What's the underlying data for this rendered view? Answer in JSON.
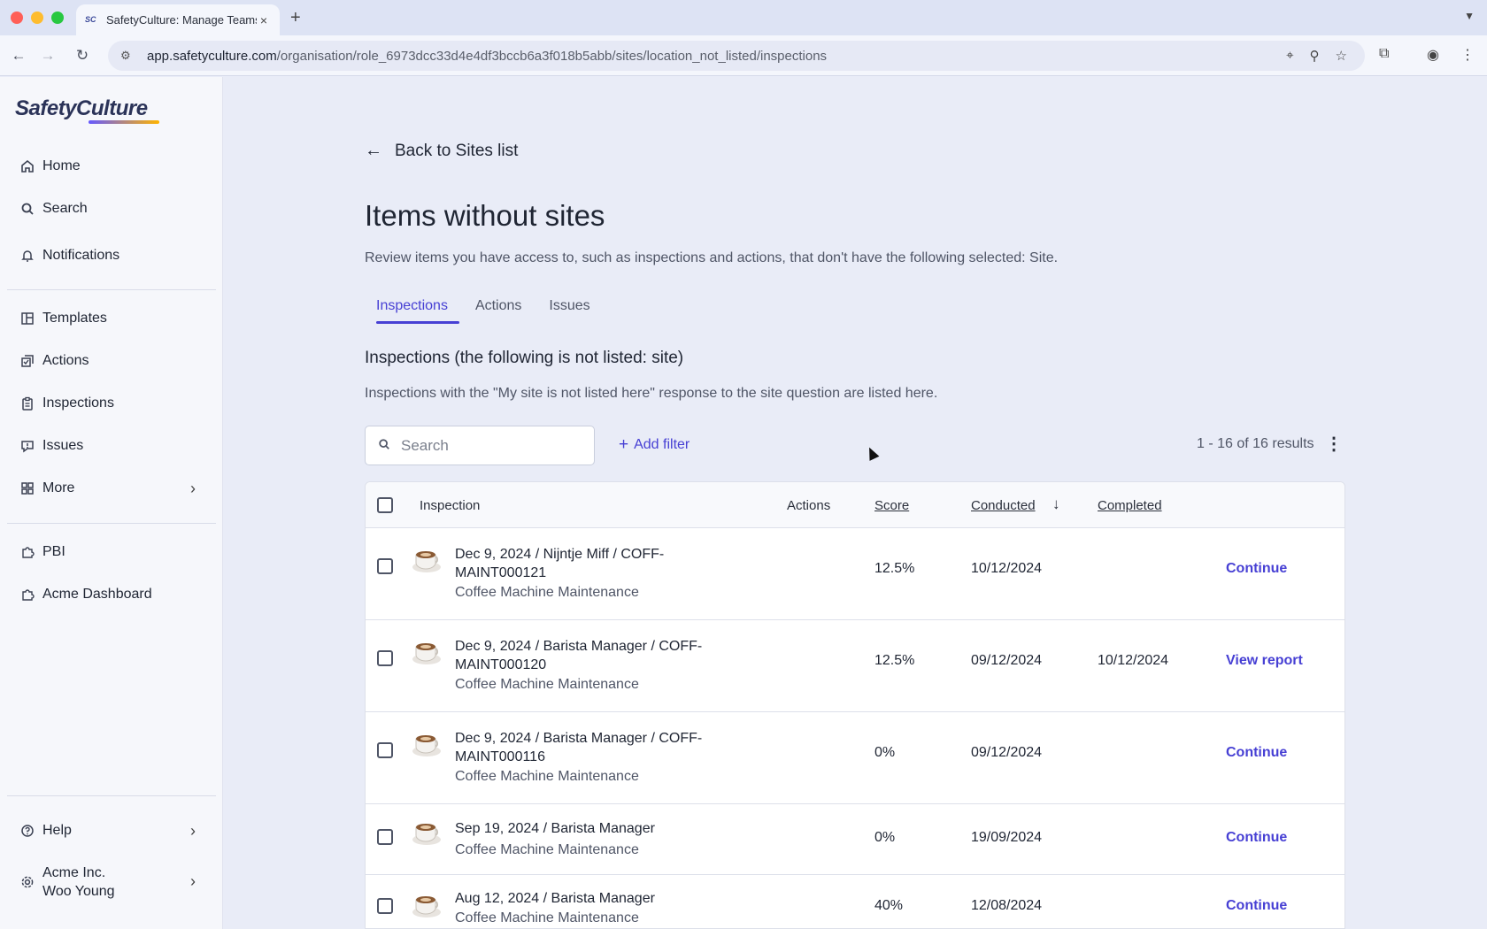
{
  "browser": {
    "tab_title": "SafetyCulture: Manage Teams",
    "favicon_text": "SC",
    "url_domain": "app.safetyculture.com",
    "url_path": "/organisation/role_6973dcc33d4e4df3bccb6a3f018b5abb/sites/location_not_listed/inspections"
  },
  "sidebar": {
    "logo": "SafetyCulture",
    "items": [
      {
        "label": "Home",
        "icon": "home-icon"
      },
      {
        "label": "Search",
        "icon": "search-icon"
      },
      {
        "label": "Notifications",
        "icon": "bell-icon"
      },
      {
        "label": "Templates",
        "icon": "templates-icon"
      },
      {
        "label": "Actions",
        "icon": "actions-icon"
      },
      {
        "label": "Inspections",
        "icon": "clipboard-icon"
      },
      {
        "label": "Issues",
        "icon": "issue-icon"
      },
      {
        "label": "More",
        "icon": "grid-icon"
      },
      {
        "label": "PBI",
        "icon": "puzzle-icon"
      },
      {
        "label": "Acme Dashboard",
        "icon": "puzzle-icon"
      }
    ],
    "help": "Help",
    "account_org": "Acme Inc.",
    "account_user": "Woo Young"
  },
  "main": {
    "back_label": "Back to Sites list",
    "title": "Items without sites",
    "description": "Review items you have access to, such as inspections and actions, that don't have the following selected: Site.",
    "tabs": [
      "Inspections",
      "Actions",
      "Issues"
    ],
    "section_title": "Inspections (the following is not listed: site)",
    "section_desc": "Inspections with the \"My site is not listed here\" response to the site question are listed here.",
    "search_placeholder": "Search",
    "add_filter": "Add filter",
    "results": "1 - 16 of 16 results"
  },
  "table": {
    "headers": {
      "inspection": "Inspection",
      "actions": "Actions",
      "score": "Score",
      "conducted": "Conducted",
      "completed": "Completed"
    },
    "rows": [
      {
        "title_line1": "Dec 9, 2024 / Nijntje Miff / COFF-",
        "title_line2": "MAINT000121",
        "template": "Coffee Machine Maintenance",
        "score": "12.5%",
        "conducted": "10/12/2024",
        "completed": "",
        "action": "Continue"
      },
      {
        "title_line1": "Dec 9, 2024 / Barista Manager / COFF-",
        "title_line2": "MAINT000120",
        "template": "Coffee Machine Maintenance",
        "score": "12.5%",
        "conducted": "09/12/2024",
        "completed": "10/12/2024",
        "action": "View report"
      },
      {
        "title_line1": "Dec 9, 2024 / Barista Manager / COFF-",
        "title_line2": "MAINT000116",
        "template": "Coffee Machine Maintenance",
        "score": "0%",
        "conducted": "09/12/2024",
        "completed": "",
        "action": "Continue"
      },
      {
        "title_line1": "Sep 19, 2024 / Barista Manager",
        "title_line2": "",
        "template": "Coffee Machine Maintenance",
        "score": "0%",
        "conducted": "19/09/2024",
        "completed": "",
        "action": "Continue"
      },
      {
        "title_line1": "Aug 12, 2024 / Barista Manager",
        "title_line2": "",
        "template": "Coffee Machine Maintenance",
        "score": "40%",
        "conducted": "12/08/2024",
        "completed": "",
        "action": "Continue"
      }
    ]
  }
}
